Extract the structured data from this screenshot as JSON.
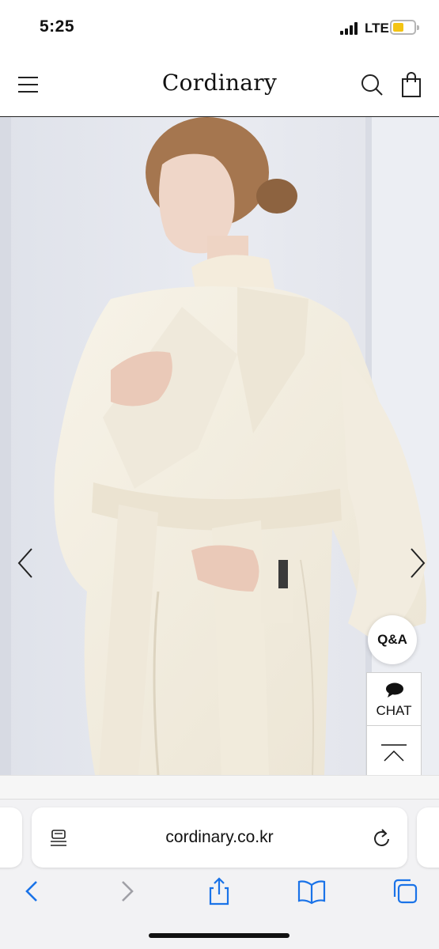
{
  "status_bar": {
    "time": "5:25",
    "network": "LTE"
  },
  "header": {
    "logo": "Cordinary"
  },
  "hero": {
    "alt": "Model in cream wrap coat"
  },
  "widgets": {
    "qa_label": "Q&A",
    "chat_label": "CHAT"
  },
  "browser": {
    "url": "cordinary.co.kr"
  },
  "colors": {
    "battery": "#f3c414",
    "accent_link": "#1a73e8",
    "coat": "#f4efe2",
    "background": "#e4e6ec"
  },
  "icons": [
    "menu-icon",
    "search-icon",
    "bag-icon",
    "chevron-left-icon",
    "chevron-right-icon",
    "chat-bubble-icon",
    "scroll-top-icon",
    "reader-icon",
    "reload-icon",
    "back-icon",
    "forward-icon",
    "share-icon",
    "bookmarks-icon",
    "tabs-icon"
  ]
}
